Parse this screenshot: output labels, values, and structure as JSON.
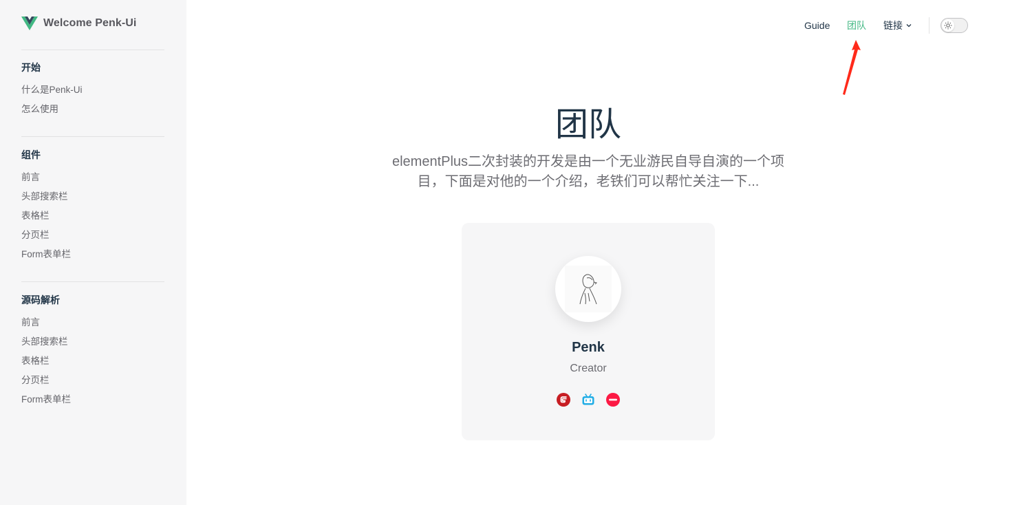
{
  "brand": {
    "title": "Welcome Penk-Ui",
    "logo_icon": "vue-logo-icon"
  },
  "sidebar": {
    "groups": [
      {
        "title": "开始",
        "items": [
          "什么是Penk-Ui",
          "怎么使用"
        ]
      },
      {
        "title": "组件",
        "items": [
          "前言",
          "头部搜索栏",
          "表格栏",
          "分页栏",
          "Form表单栏"
        ]
      },
      {
        "title": "源码解析",
        "items": [
          "前言",
          "头部搜索栏",
          "表格栏",
          "分页栏",
          "Form表单栏"
        ]
      }
    ]
  },
  "nav": {
    "guide": "Guide",
    "team": "团队",
    "links": "链接",
    "theme_toggle_icon": "sun-icon"
  },
  "hero": {
    "title": "团队",
    "description": "elementPlus二次封装的开发是由一个无业游民自导自演的一个项目，下面是对他的一个介绍，老铁们可以帮忙关注一下..."
  },
  "member": {
    "name": "Penk",
    "role": "Creator",
    "socials": [
      "gitee-icon",
      "bilibili-icon",
      "csdn-icon"
    ]
  },
  "colors": {
    "accent": "#42b883",
    "text": "#213547",
    "sidebar_bg": "#f6f6f7",
    "annotation": "#ff2a1a"
  }
}
